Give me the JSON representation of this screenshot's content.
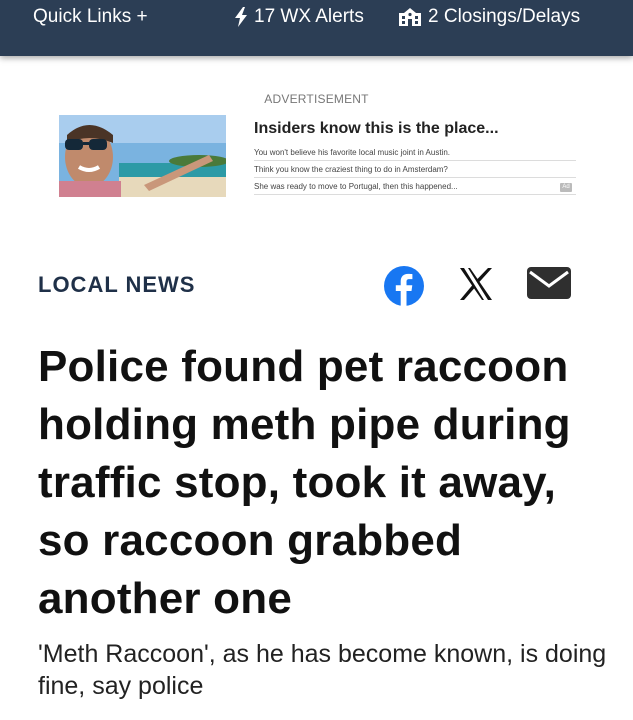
{
  "topbar": {
    "quick_links": "Quick Links +",
    "wx_alerts": "17 WX Alerts",
    "closings": "2 Closings/Delays"
  },
  "ad": {
    "label": "ADVERTISEMENT",
    "headline": "Insiders know this is the place...",
    "lines": [
      "You won't believe his favorite local music joint in Austin.",
      "Think you know the craziest thing to do in Amsterdam?",
      "She was ready to move to Portugal, then this happened..."
    ],
    "badge": "Ad"
  },
  "article": {
    "section": "LOCAL NEWS",
    "headline": "Police found pet raccoon holding meth pipe during traffic stop, took it away, so raccoon grabbed another one",
    "subhead": "'Meth Raccoon', as he has become known, is doing fine, say police"
  },
  "colors": {
    "topbar": "#2c3e55",
    "facebook": "#1877f2",
    "section_text": "#1f3048"
  },
  "icons": [
    "lightning-icon",
    "school-building-icon",
    "facebook-icon",
    "x-icon",
    "mail-icon"
  ]
}
